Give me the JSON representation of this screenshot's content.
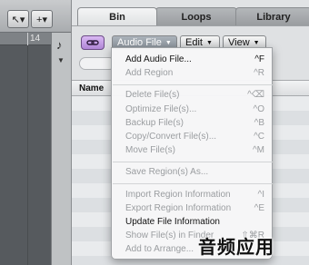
{
  "arrange": {
    "ruler_number": "14",
    "tools": {
      "pointer": "↖▾",
      "plus": "+▾"
    },
    "note_icon": "♪",
    "down_arrow": "▼"
  },
  "tabs": [
    {
      "label": "Bin",
      "active": true
    },
    {
      "label": "Loops",
      "active": false
    },
    {
      "label": "Library",
      "active": false
    }
  ],
  "toolbar": {
    "link_icon": "link-icon",
    "audio_file": "Audio File",
    "edit": "Edit",
    "view": "View",
    "arrow": "▼"
  },
  "table": {
    "columns": [
      "Name"
    ]
  },
  "menu": {
    "groups": [
      [
        {
          "label": "Add Audio File...",
          "shortcut": "^F",
          "enabled": true
        },
        {
          "label": "Add Region",
          "shortcut": "^R",
          "enabled": false
        }
      ],
      [
        {
          "label": "Delete File(s)",
          "shortcut": "^⌫",
          "enabled": false
        },
        {
          "label": "Optimize File(s)...",
          "shortcut": "^O",
          "enabled": false
        },
        {
          "label": "Backup File(s)",
          "shortcut": "^B",
          "enabled": false
        },
        {
          "label": "Copy/Convert File(s)...",
          "shortcut": "^C",
          "enabled": false
        },
        {
          "label": "Move File(s)",
          "shortcut": "^M",
          "enabled": false
        }
      ],
      [
        {
          "label": "Save Region(s) As...",
          "shortcut": "",
          "enabled": false
        }
      ],
      [
        {
          "label": "Import Region Information",
          "shortcut": "^I",
          "enabled": false
        },
        {
          "label": "Export Region Information",
          "shortcut": "^E",
          "enabled": false
        },
        {
          "label": "Update File Information",
          "shortcut": "",
          "enabled": true
        },
        {
          "label": "Show File(s) in Finder",
          "shortcut": "⇧⌘R",
          "enabled": false
        },
        {
          "label": "Add to Arrange...",
          "shortcut": "",
          "enabled": false
        }
      ]
    ]
  },
  "watermark": "音频应用"
}
